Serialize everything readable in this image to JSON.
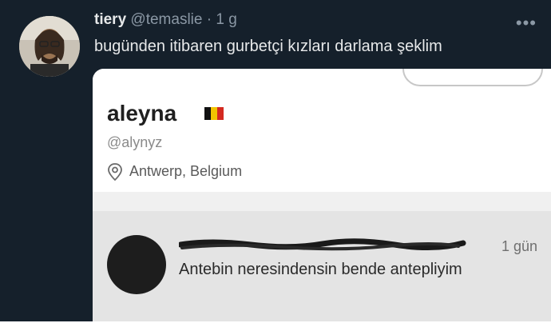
{
  "tweet": {
    "display_name": "tiery",
    "handle": "@temaslie",
    "separator": "·",
    "time": "1 g",
    "text": "bugünden itibaren gurbetçi kızları darlama şeklim",
    "more_icon": "more-dots-icon"
  },
  "photo": {
    "profile_name": "aleyna",
    "profile_handle": "@alynyz",
    "location": "Antwerp, Belgium",
    "flag_colors": [
      "#111111",
      "#f2c400",
      "#d42a20"
    ],
    "reply": {
      "time": "1 gün",
      "text": "Antebin neresindensin bende  antepliyim"
    }
  }
}
